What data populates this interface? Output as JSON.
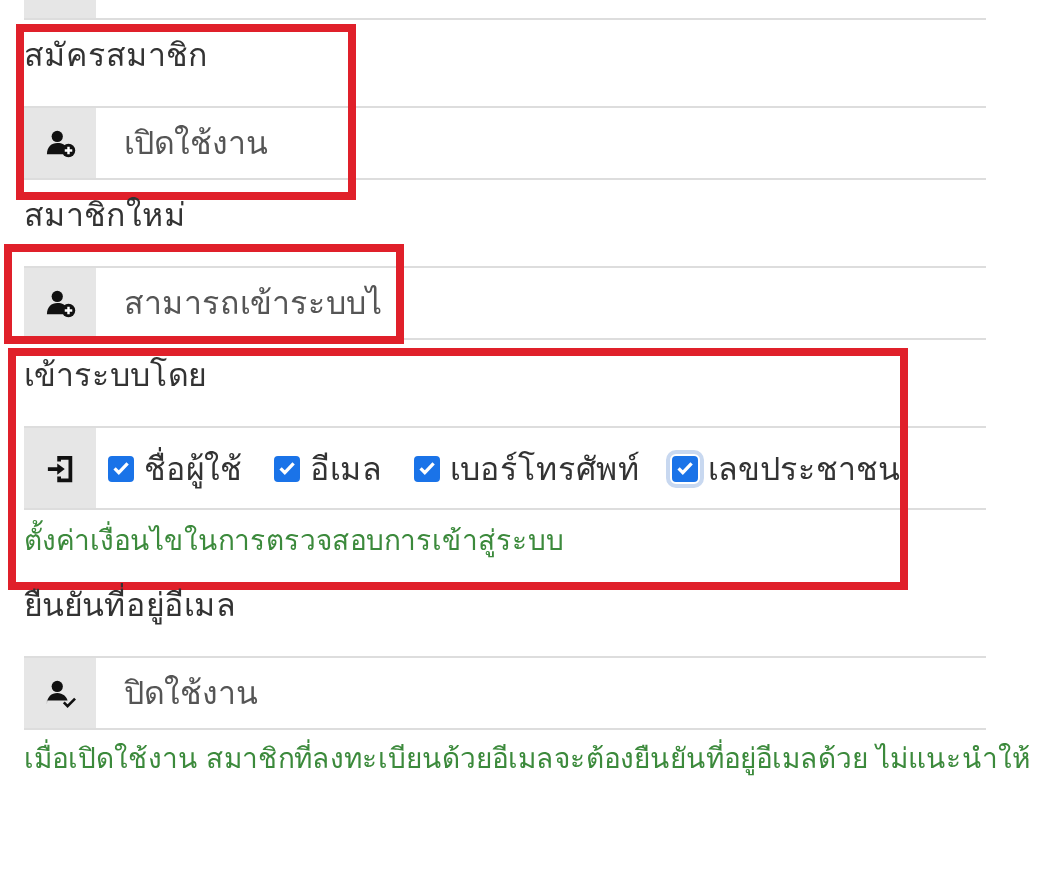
{
  "sections": [
    {
      "kind": "cut"
    },
    {
      "kind": "select",
      "label": "สมัครสมาชิก",
      "value": "เปิดใช้งาน",
      "highlighted": true
    },
    {
      "kind": "select",
      "label": "สมาชิกใหม่",
      "value": "สามารถเข้าระบบไ",
      "highlighted": true
    },
    {
      "kind": "checks",
      "label": "เข้าระบบโดย",
      "options": [
        {
          "label": "ชื่อผู้ใช้",
          "checked": true
        },
        {
          "label": "อีเมล",
          "checked": true
        },
        {
          "label": "เบอร์โทรศัพท์",
          "checked": true
        },
        {
          "label": "เลขประชาชน",
          "checked": true,
          "focused": true
        }
      ],
      "help": "ตั้งค่าเงื่อนไขในการตรวจสอบการเข้าสู่ระบบ",
      "highlighted": true
    },
    {
      "kind": "select",
      "label": "ยืนยันที่อยู่อีเมล",
      "value": "ปิดใช้งาน",
      "help": "เมื่อเปิดใช้งาน สมาชิกที่ลงทะเบียนด้วยอีเมลจะต้องยืนยันที่อยู่อีเมลด้วย ไม่แนะนำให้",
      "highlighted": false
    }
  ]
}
